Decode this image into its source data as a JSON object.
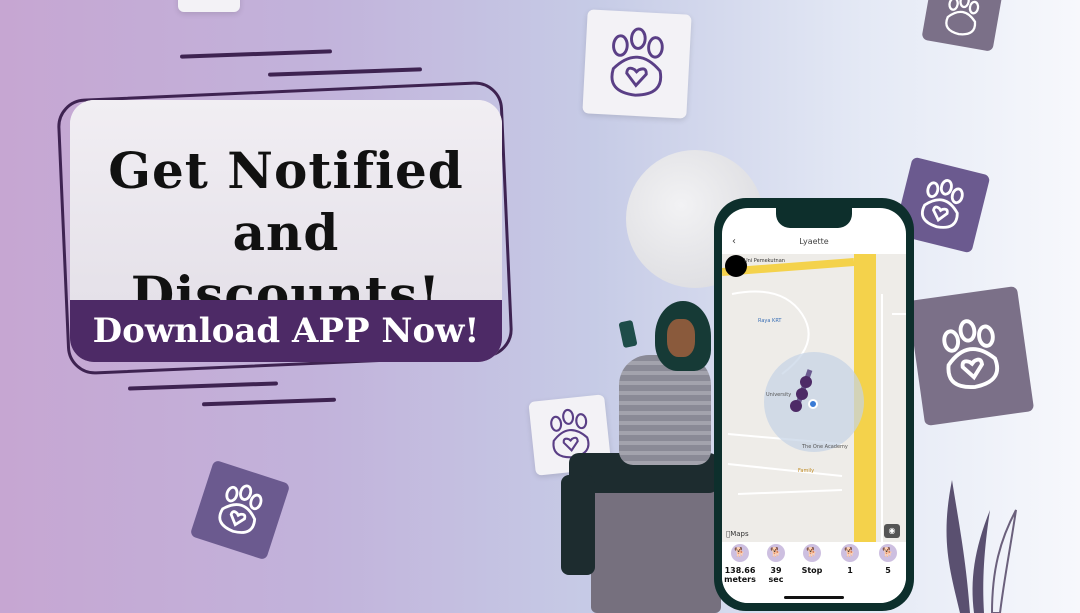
{
  "banner": {
    "headline_line1": "Get Notified",
    "headline_line2": "and Discounts!",
    "cta_label": "Download APP Now!"
  },
  "phone": {
    "title": "Lyaette",
    "back_icon": "chevron-left-icon",
    "map_label": "Maps",
    "camera_icon": "camera-icon",
    "place_labels": [
      "Uni Pemekutnan",
      "Raya KRT",
      "University",
      "The One Academy",
      "Family"
    ],
    "stats": [
      {
        "icon": "dog-distance-icon",
        "value": "138.66",
        "unit": "meters"
      },
      {
        "icon": "dog-time-icon",
        "value": "39",
        "unit": "sec"
      },
      {
        "icon": "dog-stop-icon",
        "value": "Stop",
        "unit": ""
      },
      {
        "icon": "dog-walk-icon",
        "value": "1",
        "unit": ""
      },
      {
        "icon": "dog-run-icon",
        "value": "5",
        "unit": ""
      }
    ]
  },
  "colors": {
    "brand_purple": "#4d2a66",
    "tile_dark": "#6b5a8f",
    "phone_frame": "#0d2f2c",
    "map_road": "#f4d24b"
  },
  "decor_icons": [
    "paw-heart-icon",
    "moon-icon",
    "plant-icon"
  ]
}
